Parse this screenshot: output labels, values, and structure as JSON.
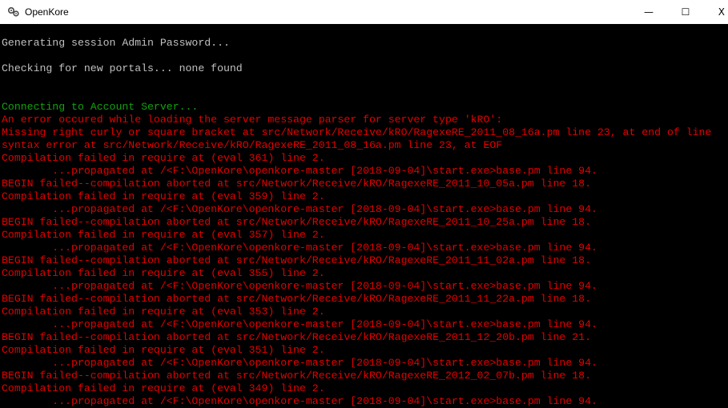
{
  "window": {
    "title": "OpenKore",
    "icon": "gears-icon",
    "controls": {
      "minimize": "—",
      "maximize": "☐",
      "close": "X"
    }
  },
  "colors": {
    "default_text": "#c0c0c0",
    "info_text": "#13a10e",
    "error_text": "#e50000",
    "background": "#000000"
  },
  "console": {
    "lines": [
      {
        "text": "Generating session Admin Password...",
        "color": "white"
      },
      {
        "text": "",
        "color": "white"
      },
      {
        "text": "Checking for new portals... none found",
        "color": "white"
      },
      {
        "text": "",
        "color": "white"
      },
      {
        "text": "",
        "color": "white"
      },
      {
        "text": "Connecting to Account Server...",
        "color": "green"
      },
      {
        "text": "An error occured while loading the server message parser for server type 'kRO':",
        "color": "red"
      },
      {
        "text": "Missing right curly or square bracket at src/Network/Receive/kRO/RagexeRE_2011_08_16a.pm line 23, at end of line",
        "color": "red"
      },
      {
        "text": "syntax error at src/Network/Receive/kRO/RagexeRE_2011_08_16a.pm line 23, at EOF",
        "color": "red"
      },
      {
        "text": "Compilation failed in require at (eval 361) line 2.",
        "color": "red"
      },
      {
        "text": "        ...propagated at /<F:\\OpenKore\\openkore-master [2018-09-04]\\start.exe>base.pm line 94.",
        "color": "red"
      },
      {
        "text": "BEGIN failed--compilation aborted at src/Network/Receive/kRO/RagexeRE_2011_10_05a.pm line 18.",
        "color": "red"
      },
      {
        "text": "Compilation failed in require at (eval 359) line 2.",
        "color": "red"
      },
      {
        "text": "        ...propagated at /<F:\\OpenKore\\openkore-master [2018-09-04]\\start.exe>base.pm line 94.",
        "color": "red"
      },
      {
        "text": "BEGIN failed--compilation aborted at src/Network/Receive/kRO/RagexeRE_2011_10_25a.pm line 18.",
        "color": "red"
      },
      {
        "text": "Compilation failed in require at (eval 357) line 2.",
        "color": "red"
      },
      {
        "text": "        ...propagated at /<F:\\OpenKore\\openkore-master [2018-09-04]\\start.exe>base.pm line 94.",
        "color": "red"
      },
      {
        "text": "BEGIN failed--compilation aborted at src/Network/Receive/kRO/RagexeRE_2011_11_02a.pm line 18.",
        "color": "red"
      },
      {
        "text": "Compilation failed in require at (eval 355) line 2.",
        "color": "red"
      },
      {
        "text": "        ...propagated at /<F:\\OpenKore\\openkore-master [2018-09-04]\\start.exe>base.pm line 94.",
        "color": "red"
      },
      {
        "text": "BEGIN failed--compilation aborted at src/Network/Receive/kRO/RagexeRE_2011_11_22a.pm line 18.",
        "color": "red"
      },
      {
        "text": "Compilation failed in require at (eval 353) line 2.",
        "color": "red"
      },
      {
        "text": "        ...propagated at /<F:\\OpenKore\\openkore-master [2018-09-04]\\start.exe>base.pm line 94.",
        "color": "red"
      },
      {
        "text": "BEGIN failed--compilation aborted at src/Network/Receive/kRO/RagexeRE_2011_12_20b.pm line 21.",
        "color": "red"
      },
      {
        "text": "Compilation failed in require at (eval 351) line 2.",
        "color": "red"
      },
      {
        "text": "        ...propagated at /<F:\\OpenKore\\openkore-master [2018-09-04]\\start.exe>base.pm line 94.",
        "color": "red"
      },
      {
        "text": "BEGIN failed--compilation aborted at src/Network/Receive/kRO/RagexeRE_2012_02_07b.pm line 18.",
        "color": "red"
      },
      {
        "text": "Compilation failed in require at (eval 349) line 2.",
        "color": "red"
      },
      {
        "text": "        ...propagated at /<F:\\OpenKore\\openkore-master [2018-09-04]\\start.exe>base.pm line 94.",
        "color": "red"
      }
    ]
  }
}
